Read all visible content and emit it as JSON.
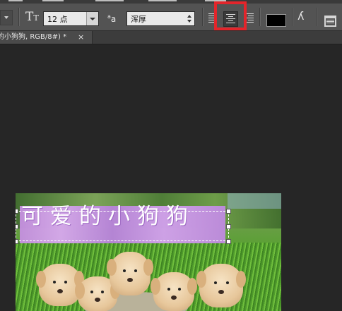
{
  "options_bar": {
    "tool_glyph": "T",
    "font_size_value": "12 点",
    "aa_label": "a",
    "aa_small": "a",
    "antialias_value": "浑厚",
    "align_left_icon": "align-left-icon",
    "align_center_icon": "align-center-icon",
    "align_right_icon": "align-right-icon",
    "text_color": "#000000",
    "warp_icon": "warp-text-icon",
    "panel_icon": "character-panel-icon"
  },
  "document_tab": {
    "title": "的小狗狗, RGB/8#) *",
    "close_label": "×"
  },
  "canvas": {
    "layer_text": "可爱的小狗狗"
  },
  "colors": {
    "highlight": "#e3252b",
    "options_bg": "#535353",
    "workspace_bg": "#262626"
  }
}
